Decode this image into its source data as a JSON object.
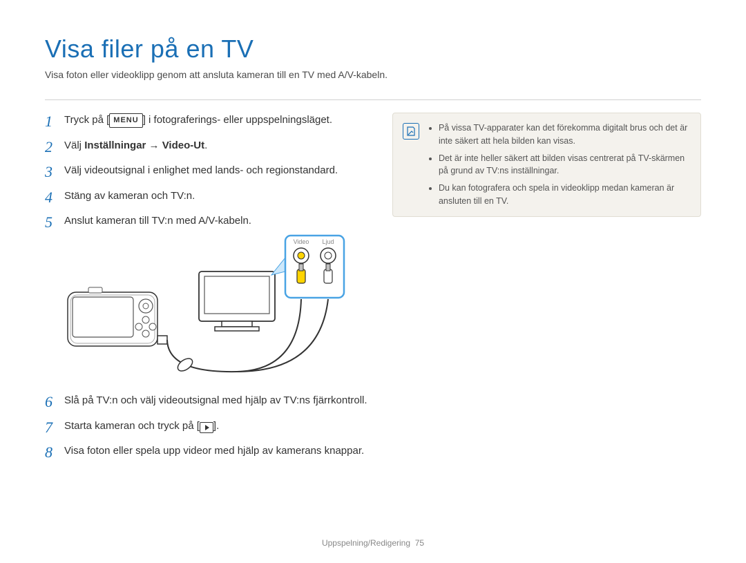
{
  "title": "Visa filer på en TV",
  "intro": "Visa foton eller videoklipp genom att ansluta kameran till en TV med A/V-kabeln.",
  "steps": {
    "s1a": "Tryck på [",
    "s1b": "] i fotograferings- eller uppspelningsläget.",
    "menu_label": "MENU",
    "s2a": "Välj ",
    "s2b": "Inställningar → Video-Ut",
    "s2c": ".",
    "s3": "Välj videoutsignal i enlighet med lands- och regionstandard.",
    "s4": "Stäng av kameran och TV:n.",
    "s5": "Anslut kameran till TV:n med A/V-kabeln.",
    "s6": "Slå på TV:n och välj videoutsignal med hjälp av TV:ns fjärrkontroll.",
    "s7a": "Starta kameran och tryck på [",
    "s7b": "].",
    "s8": "Visa foton eller spela upp videor med hjälp av kamerans knappar."
  },
  "diagram": {
    "video_label": "Video",
    "audio_label": "Ljud"
  },
  "notes": {
    "n1": "På vissa TV-apparater kan det förekomma digitalt brus och det är inte säkert att hela bilden kan visas.",
    "n2": "Det är inte heller säkert att bilden visas centrerat på TV-skärmen på grund av TV:ns inställningar.",
    "n3": "Du kan fotografera och spela in videoklipp medan kameran är ansluten till en TV."
  },
  "footer": {
    "section": "Uppspelning/Redigering",
    "page": "75"
  }
}
